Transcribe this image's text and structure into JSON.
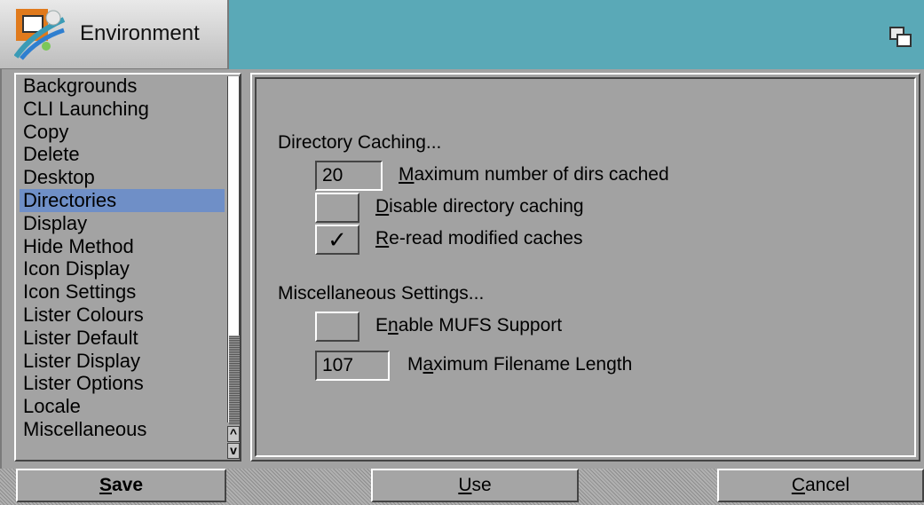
{
  "window": {
    "title": "Environment"
  },
  "icons": {
    "app": "environment-prefs-icon",
    "depth": "depth-gadget-icon",
    "check": "✓",
    "arrow_up": "^",
    "arrow_down": "v"
  },
  "sidebar": {
    "items": [
      {
        "label": "Backgrounds"
      },
      {
        "label": "CLI Launching"
      },
      {
        "label": "Copy"
      },
      {
        "label": "Delete"
      },
      {
        "label": "Desktop"
      },
      {
        "label": "Directories",
        "selected": true
      },
      {
        "label": "Display"
      },
      {
        "label": "Hide Method"
      },
      {
        "label": "Icon Display"
      },
      {
        "label": "Icon Settings"
      },
      {
        "label": "Lister Colours"
      },
      {
        "label": "Lister Default"
      },
      {
        "label": "Lister Display"
      },
      {
        "label": "Lister Options"
      },
      {
        "label": "Locale"
      },
      {
        "label": "Miscellaneous"
      }
    ]
  },
  "settings": {
    "directory_caching": {
      "heading": "Directory Caching...",
      "max_dirs": {
        "value": "20",
        "label_u": "M",
        "label_rest": "aximum number of dirs cached"
      },
      "disable_caching": {
        "checked": false,
        "label_u": "D",
        "label_rest": "isable directory caching"
      },
      "reread_modified": {
        "checked": true,
        "label_u": "R",
        "label_rest": "e-read modified caches"
      }
    },
    "misc": {
      "heading": "Miscellaneous Settings...",
      "mufs": {
        "checked": false,
        "label_pre": "E",
        "label_u": "n",
        "label_rest": "able MUFS Support"
      },
      "max_filename": {
        "value": "107",
        "label_pre": "M",
        "label_u": "a",
        "label_rest": "ximum Filename Length"
      }
    }
  },
  "buttons": {
    "save": {
      "u": "S",
      "rest": "ave"
    },
    "use": {
      "u": "U",
      "rest": "se"
    },
    "cancel": {
      "u": "C",
      "rest": "ancel"
    }
  },
  "colors": {
    "titlebar": "#5aa9b7",
    "selection": "#6f8fc7",
    "panel": "#a2a2a2"
  }
}
